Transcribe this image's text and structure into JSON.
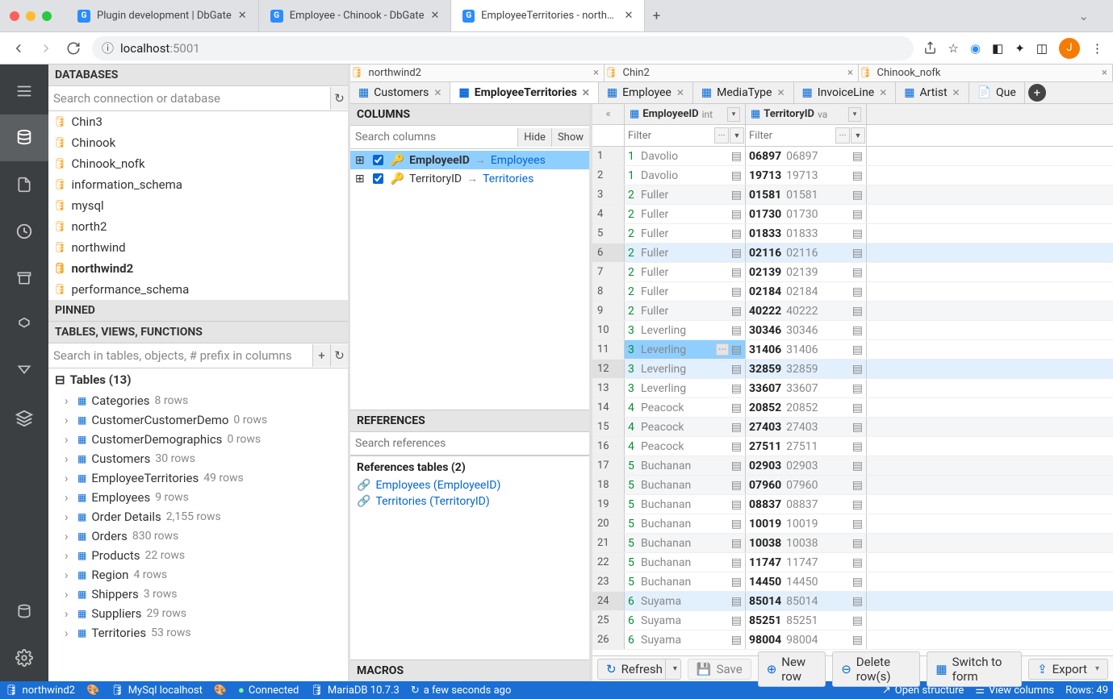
{
  "chrome_tabs": [
    {
      "title": "Plugin development | DbGate",
      "active": false
    },
    {
      "title": "Employee - Chinook - DbGate",
      "active": false
    },
    {
      "title": "EmployeeTerritories - northwin…",
      "active": true
    }
  ],
  "address": {
    "host": "localhost",
    "port": ":5001",
    "info_icon": "ⓘ"
  },
  "databases_title": "DATABASES",
  "db_search_placeholder": "Search connection or database",
  "db_list": [
    {
      "name": "Chin3"
    },
    {
      "name": "Chinook"
    },
    {
      "name": "Chinook_nofk"
    },
    {
      "name": "information_schema"
    },
    {
      "name": "mysql"
    },
    {
      "name": "north2"
    },
    {
      "name": "northwind"
    },
    {
      "name": "northwind2",
      "bold": true
    },
    {
      "name": "performance_schema"
    }
  ],
  "pinned_title": "PINNED",
  "tvf_title": "TABLES, VIEWS, FUNCTIONS",
  "tvf_search_placeholder": "Search in tables, objects, # prefix in columns",
  "tables_header": "Tables (13)",
  "tables": [
    {
      "name": "Categories",
      "count": "8 rows"
    },
    {
      "name": "CustomerCustomerDemo",
      "count": "0 rows"
    },
    {
      "name": "CustomerDemographics",
      "count": "0 rows"
    },
    {
      "name": "Customers",
      "count": "30 rows"
    },
    {
      "name": "EmployeeTerritories",
      "count": "49 rows"
    },
    {
      "name": "Employees",
      "count": "9 rows"
    },
    {
      "name": "Order Details",
      "count": "2,155 rows"
    },
    {
      "name": "Orders",
      "count": "830 rows"
    },
    {
      "name": "Products",
      "count": "22 rows"
    },
    {
      "name": "Region",
      "count": "4 rows"
    },
    {
      "name": "Shippers",
      "count": "3 rows"
    },
    {
      "name": "Suppliers",
      "count": "29 rows"
    },
    {
      "name": "Territories",
      "count": "53 rows"
    }
  ],
  "topband": [
    {
      "label": "northwind2"
    },
    {
      "label": "Chin2"
    },
    {
      "label": "Chinook_nofk"
    }
  ],
  "doctabs": [
    {
      "label": "Customers",
      "icon": "tb"
    },
    {
      "label": "EmployeeTerritories",
      "icon": "tb",
      "active": true
    },
    {
      "label": "Employee",
      "icon": "tb"
    },
    {
      "label": "MediaType",
      "icon": "tb"
    },
    {
      "label": "InvoiceLine",
      "icon": "tb"
    },
    {
      "label": "Artist",
      "icon": "tb"
    },
    {
      "label": "Que",
      "icon": "doc",
      "noclose": true
    }
  ],
  "columns_header": "COLUMNS",
  "columns_search": "Search columns",
  "columns_hide": "Hide",
  "columns_show": "Show",
  "cols": [
    {
      "name": "EmployeeID",
      "ref": "Employees",
      "sel": true
    },
    {
      "name": "TerritoryID",
      "ref": "Territories",
      "sel": false
    }
  ],
  "references_header": "REFERENCES",
  "references_search": "Search references",
  "references_tables_header": "References tables (2)",
  "ref_links": [
    {
      "label": "Employees (EmployeeID)"
    },
    {
      "label": "Territories (TerritoryID)"
    }
  ],
  "macros_header": "MACROS",
  "grid_cols": [
    {
      "name": "EmployeeID",
      "type": "int"
    },
    {
      "name": "TerritoryID",
      "type": "va"
    }
  ],
  "filter_placeholder": "Filter",
  "rows": [
    {
      "n": "1",
      "fk": "1",
      "emp": "Davolio",
      "t": "06897",
      "tg": "06897"
    },
    {
      "n": "2",
      "fk": "1",
      "emp": "Davolio",
      "t": "19713",
      "tg": "19713"
    },
    {
      "n": "3",
      "fk": "2",
      "emp": "Fuller",
      "t": "01581",
      "tg": "01581",
      "stripe": true
    },
    {
      "n": "4",
      "fk": "2",
      "emp": "Fuller",
      "t": "01730",
      "tg": "01730"
    },
    {
      "n": "5",
      "fk": "2",
      "emp": "Fuller",
      "t": "01833",
      "tg": "01833"
    },
    {
      "n": "6",
      "fk": "2",
      "emp": "Fuller",
      "t": "02116",
      "tg": "02116",
      "sel": true
    },
    {
      "n": "7",
      "fk": "2",
      "emp": "Fuller",
      "t": "02139",
      "tg": "02139"
    },
    {
      "n": "8",
      "fk": "2",
      "emp": "Fuller",
      "t": "02184",
      "tg": "02184"
    },
    {
      "n": "9",
      "fk": "2",
      "emp": "Fuller",
      "t": "40222",
      "tg": "40222",
      "stripe": true
    },
    {
      "n": "10",
      "fk": "3",
      "emp": "Leverling",
      "t": "30346",
      "tg": "30346"
    },
    {
      "n": "11",
      "fk": "3",
      "emp": "Leverling",
      "t": "31406",
      "tg": "31406",
      "selcell": true
    },
    {
      "n": "12",
      "fk": "3",
      "emp": "Leverling",
      "t": "32859",
      "tg": "32859",
      "sel": true
    },
    {
      "n": "13",
      "fk": "3",
      "emp": "Leverling",
      "t": "33607",
      "tg": "33607"
    },
    {
      "n": "14",
      "fk": "4",
      "emp": "Peacock",
      "t": "20852",
      "tg": "20852"
    },
    {
      "n": "15",
      "fk": "4",
      "emp": "Peacock",
      "t": "27403",
      "tg": "27403",
      "stripe": true
    },
    {
      "n": "16",
      "fk": "4",
      "emp": "Peacock",
      "t": "27511",
      "tg": "27511"
    },
    {
      "n": "17",
      "fk": "5",
      "emp": "Buchanan",
      "t": "02903",
      "tg": "02903",
      "stripe": true
    },
    {
      "n": "18",
      "fk": "5",
      "emp": "Buchanan",
      "t": "07960",
      "tg": "07960",
      "stripe": true
    },
    {
      "n": "19",
      "fk": "5",
      "emp": "Buchanan",
      "t": "08837",
      "tg": "08837"
    },
    {
      "n": "20",
      "fk": "5",
      "emp": "Buchanan",
      "t": "10019",
      "tg": "10019"
    },
    {
      "n": "21",
      "fk": "5",
      "emp": "Buchanan",
      "t": "10038",
      "tg": "10038",
      "stripe": true
    },
    {
      "n": "22",
      "fk": "5",
      "emp": "Buchanan",
      "t": "11747",
      "tg": "11747"
    },
    {
      "n": "23",
      "fk": "5",
      "emp": "Buchanan",
      "t": "14450",
      "tg": "14450"
    },
    {
      "n": "24",
      "fk": "6",
      "emp": "Suyama",
      "t": "85014",
      "tg": "85014",
      "sel": true
    },
    {
      "n": "25",
      "fk": "6",
      "emp": "Suyama",
      "t": "85251",
      "tg": "85251"
    },
    {
      "n": "26",
      "fk": "6",
      "emp": "Suyama",
      "t": "98004",
      "tg": "98004"
    }
  ],
  "toolbar": {
    "refresh": "Refresh",
    "save": "Save",
    "newrow": "New row",
    "deleterows": "Delete row(s)",
    "switch": "Switch to form",
    "export": "Export"
  },
  "status": {
    "db": "northwind2",
    "conn": "MySql localhost",
    "connected": "Connected",
    "server": "MariaDB 10.7.3",
    "time": "a few seconds ago",
    "open": "Open structure",
    "view": "View columns",
    "rows": "Rows: 49"
  }
}
